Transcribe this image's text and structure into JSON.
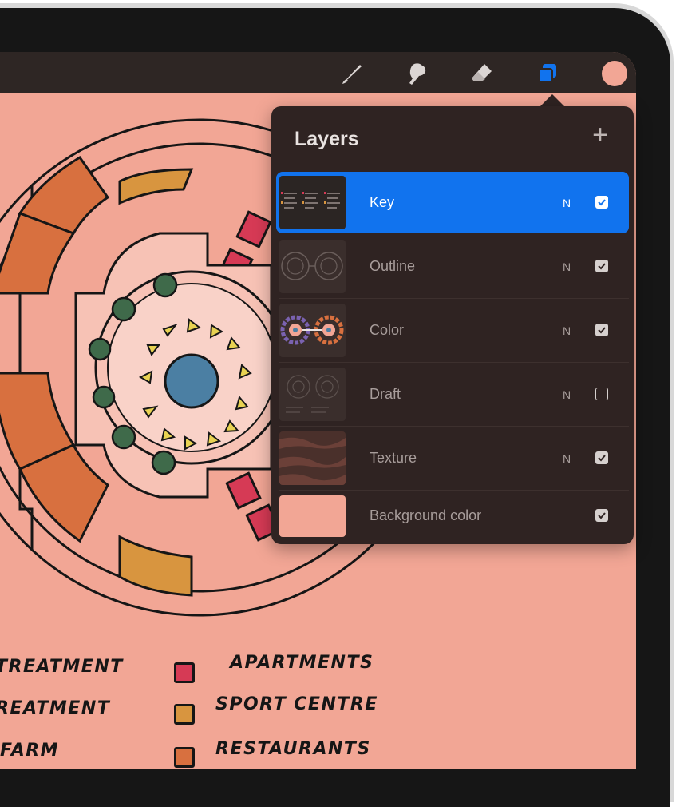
{
  "toolbar": {
    "tools": [
      {
        "name": "brush",
        "icon": "brush-icon"
      },
      {
        "name": "smudge",
        "icon": "smudge-icon"
      },
      {
        "name": "eraser",
        "icon": "eraser-icon"
      },
      {
        "name": "layers",
        "icon": "layers-icon",
        "active": true
      }
    ],
    "current_color": "#f2a695",
    "accent_color": "#1173ee"
  },
  "layers_panel": {
    "title": "Layers",
    "add_label": "+",
    "layers": [
      {
        "name": "Key",
        "mode": "N",
        "visible": true,
        "selected": true
      },
      {
        "name": "Outline",
        "mode": "N",
        "visible": true,
        "selected": false
      },
      {
        "name": "Color",
        "mode": "N",
        "visible": true,
        "selected": false
      },
      {
        "name": "Draft",
        "mode": "N",
        "visible": false,
        "selected": false
      },
      {
        "name": "Texture",
        "mode": "N",
        "visible": true,
        "selected": false
      },
      {
        "name": "Background color",
        "mode": "",
        "visible": true,
        "selected": false
      }
    ]
  },
  "legend": {
    "items_left": [
      "TREATMENT",
      "REATMENT",
      "FARM"
    ],
    "items_right": [
      {
        "label": "APARTMENTS",
        "color": "#d63a55"
      },
      {
        "label": "SPORT CENTRE",
        "color": "#d8953f"
      },
      {
        "label": "RESTAURANTS",
        "color": "#d8703f"
      }
    ]
  }
}
